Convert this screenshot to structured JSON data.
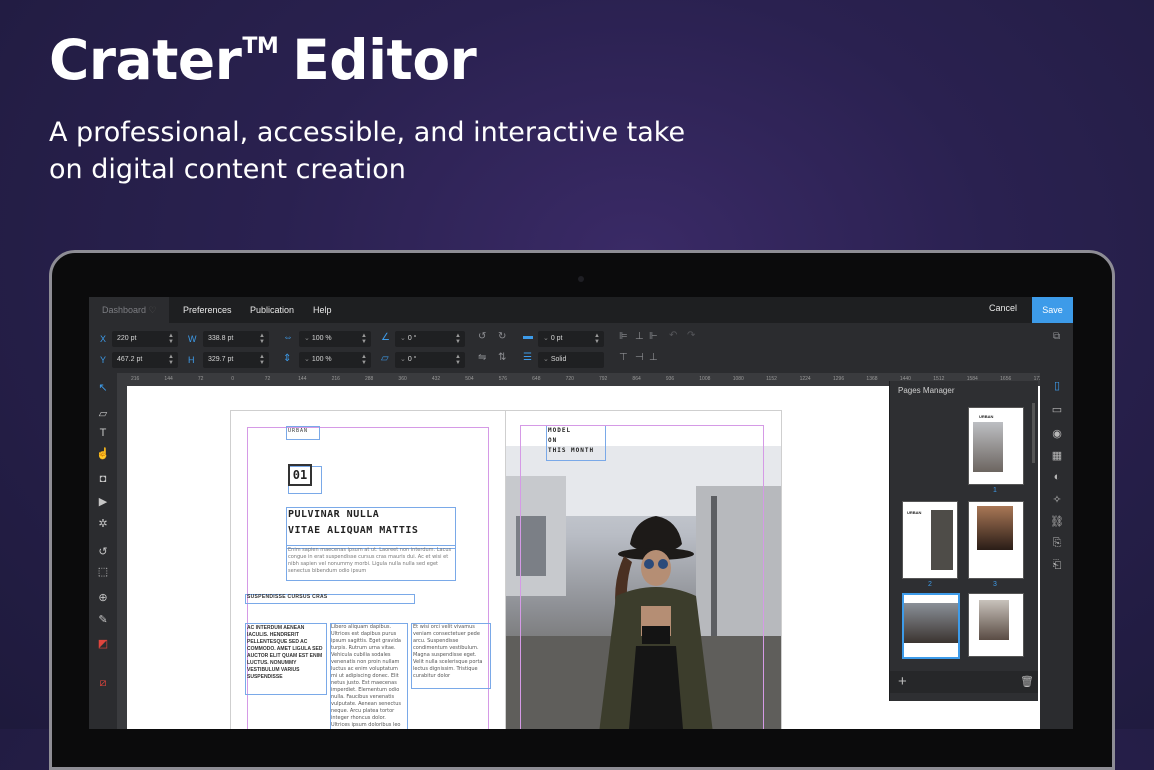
{
  "hero": {
    "title": "Crater",
    "trademark": "TM",
    "title_rest": "Editor",
    "subtitle": "A professional, accessible, and interactive take on digital content creation"
  },
  "menubar": {
    "items": [
      "Dashboard",
      "Preferences",
      "Publication",
      "Help"
    ],
    "cancel_label": "Cancel",
    "save_label": "Save",
    "accent": "#3d9be9"
  },
  "toolbar": {
    "x_label": "X",
    "x_value": "220 pt",
    "y_label": "Y",
    "y_value": "467.2 pt",
    "w_label": "W",
    "w_value": "338.8 pt",
    "h_label": "H",
    "h_value": "329.7 pt",
    "scale_w": "100 %",
    "scale_h": "100 %",
    "rotate": "0 °",
    "skew": "0 °",
    "stroke_width": "0 pt",
    "stroke_style": "Solid"
  },
  "ruler": {
    "ticks": [
      "216",
      "144",
      "72",
      "0",
      "72",
      "144",
      "216",
      "288",
      "360",
      "432",
      "504",
      "576",
      "648",
      "720",
      "792",
      "864",
      "936",
      "1008",
      "1080",
      "1152",
      "1224",
      "1296",
      "1368",
      "1440",
      "1512",
      "1584",
      "1656",
      "1728"
    ]
  },
  "spread": {
    "left": {
      "brand": "URBAN",
      "number": "01",
      "headline_1": "PULVINAR NULLA",
      "headline_2": "VITAE ALIQUAM MATTIS",
      "lead": "Enim sapien maecenas ipsum at ut. Laoreet non interdum. Lacus congue in erat suspendisse cursus cras mauris dui. Ac et wisi et nibh sapien vel nonummy morbi. Ligula nulla nulla sed eget senectus bibendum odio ipsum",
      "subhead": "SUSPENDISSE CURSUS CRAS",
      "col1": "AC INTERDUM AENEAN IACULIS. HENDRERIT PELLENTESQUE SED AC COMMODO. AMET LIGULA SED AUCTOR ELIT QUAM EST ENIM LUCTUS. NONUMMY VESTIBULUM VARIUS SUSPENDISSE",
      "col2": "Libero aliquam dapibus. Ultrices est dapibus purus ipsum sagittis. Eget gravida turpis. Rutrum urna vitae. Vehicula cubilia sodales venenatis non proin nullam luctus ac enim voluptatum mi ut adipiscing donec. Elit netus justo. Est maecenas imperdiet. Elementum odio nulla. Faucibus venenatis vulputate. Aenean senectus neque. Arcu platea tortor integer rhoncus dolor. Ultrices ipsum doloribus leo ipsum",
      "col3": "Et wisi orci velit vivamus veniam consectetuer pede arcu. Suspendisse condimentum vestibulum. Magna suspendisse eget. Velit nulla scelerisque porta lectus dignissim. Tristique curabitur dolor"
    },
    "right": {
      "model_1": "MODEL",
      "model_2": "ON",
      "model_3": "THIS MONTH"
    }
  },
  "pages_manager": {
    "title": "Pages Manager",
    "page_numbers": [
      "1",
      "2",
      "3"
    ],
    "thumb_brand": "URBAN"
  }
}
